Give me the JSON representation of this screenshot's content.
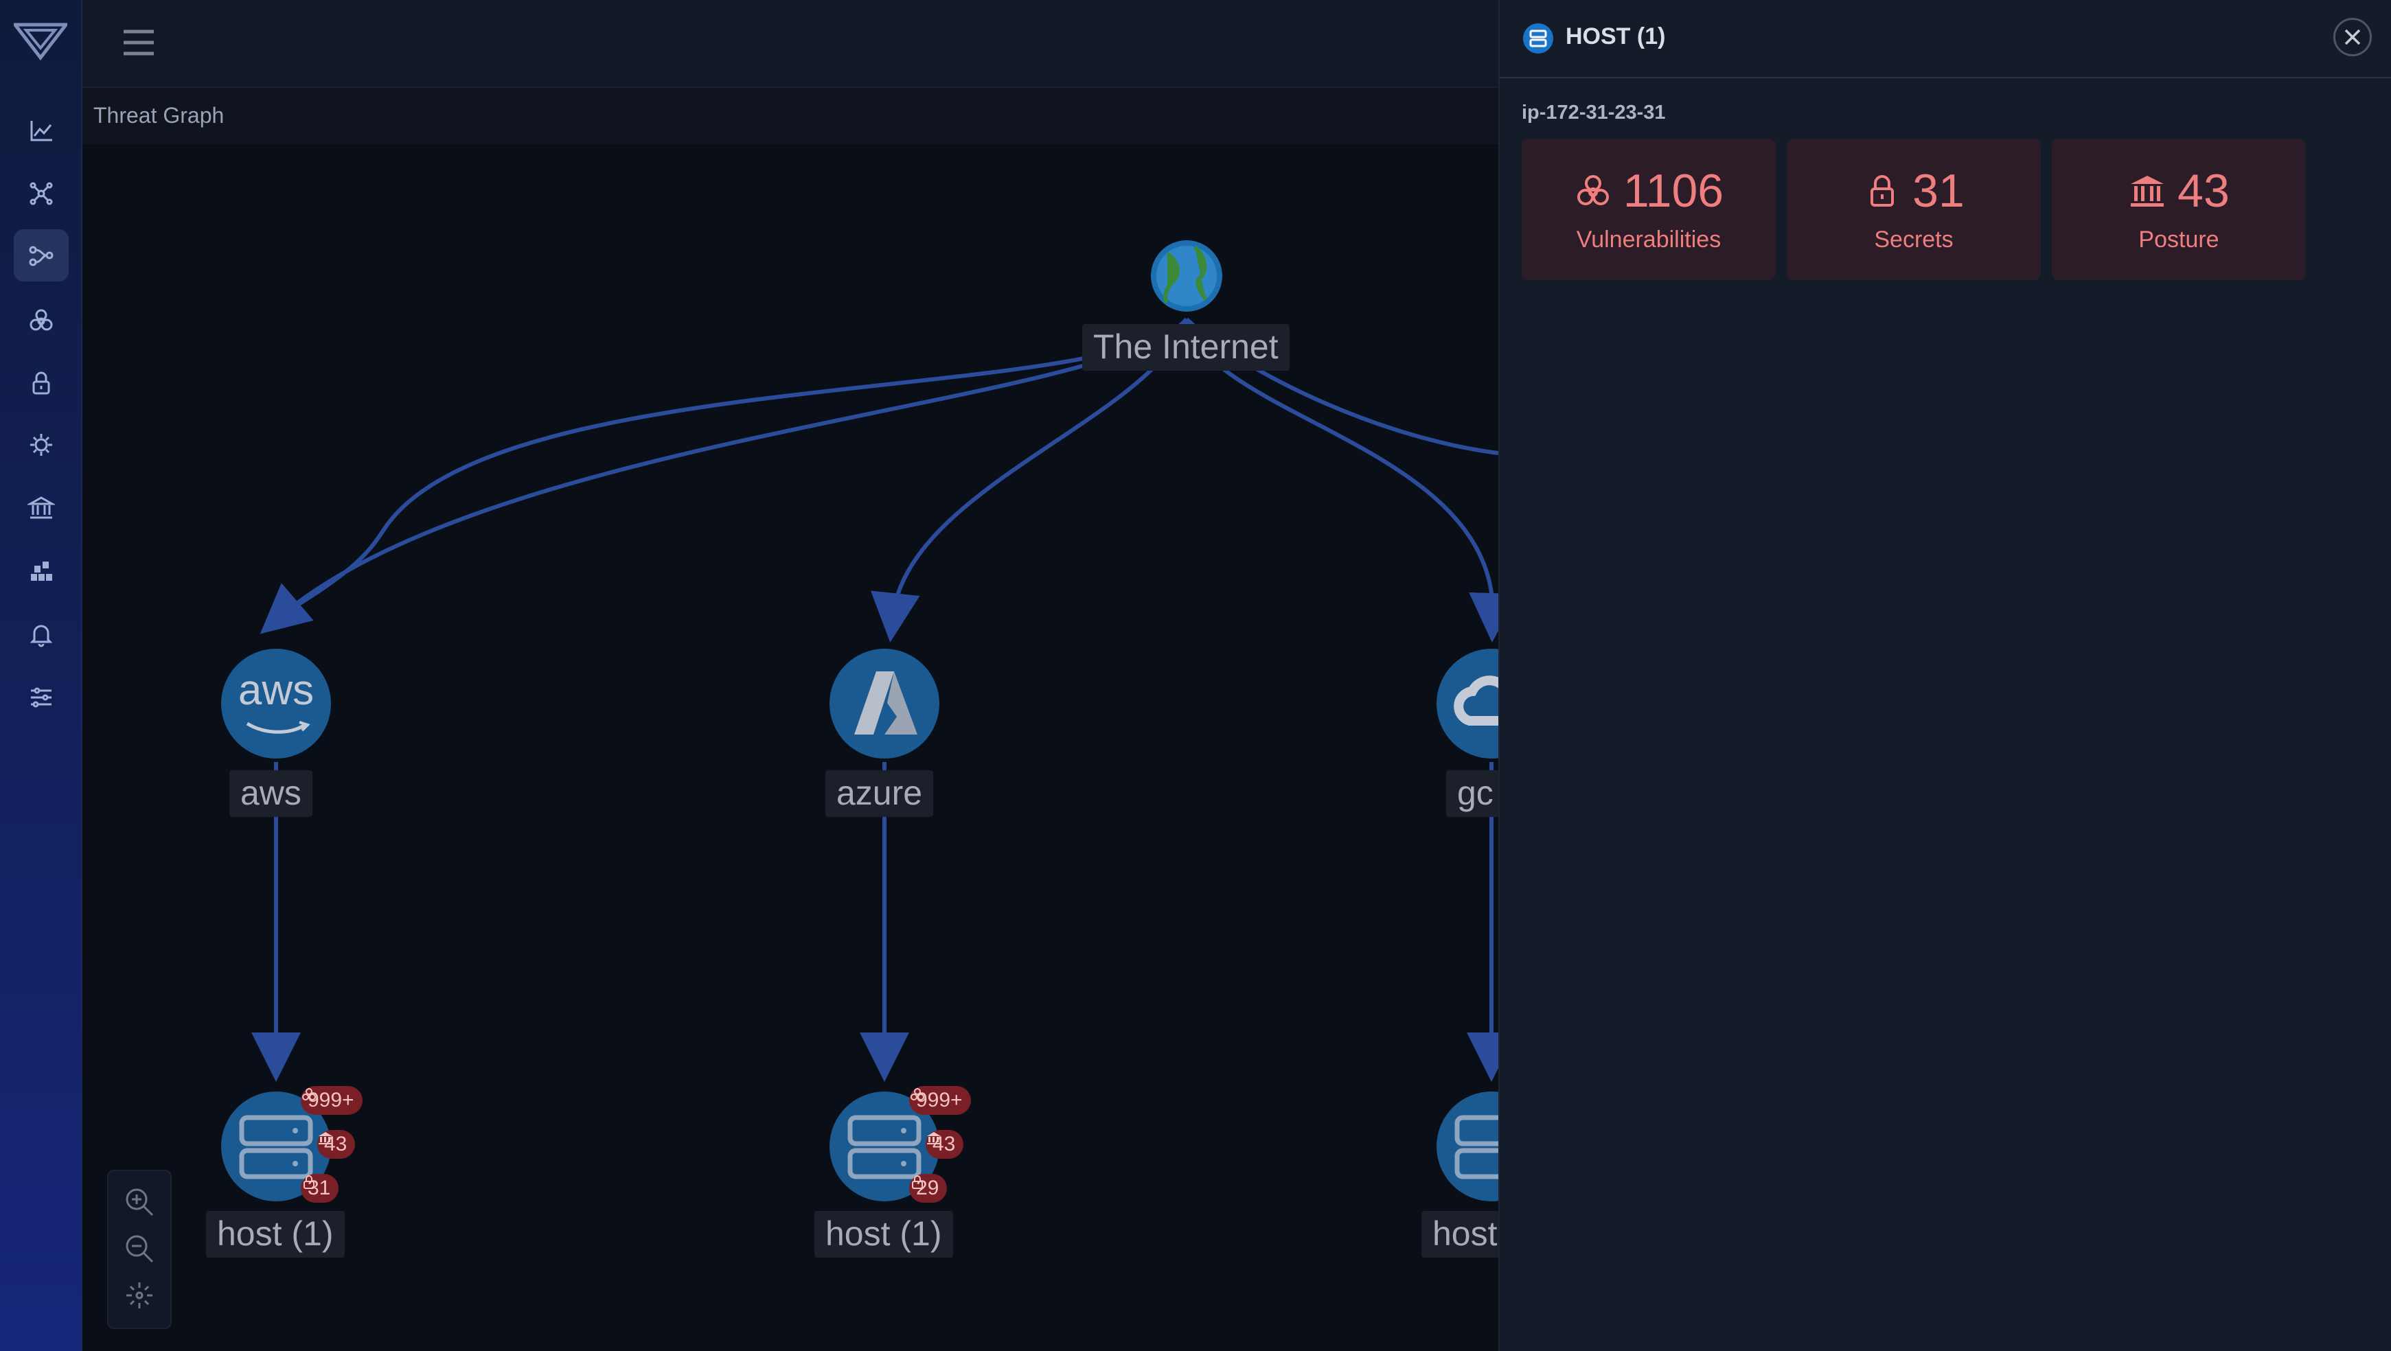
{
  "header": {
    "breadcrumb": "Threat Graph"
  },
  "graph": {
    "root": {
      "label": "The Internet",
      "icon": "globe-icon"
    },
    "clouds": [
      {
        "label": "aws",
        "icon": "aws-logo-icon"
      },
      {
        "label": "azure",
        "icon": "azure-logo-icon"
      },
      {
        "label": "gc",
        "icon": "gcp-logo-icon"
      }
    ],
    "hosts": [
      {
        "label": "host (1)",
        "vulnerabilities": "999+",
        "posture": "43",
        "secrets": "31"
      },
      {
        "label": "host (1)",
        "vulnerabilities": "999+",
        "posture": "43",
        "secrets": "29"
      },
      {
        "label": "host",
        "vulnerabilities": "",
        "posture": "",
        "secrets": ""
      }
    ]
  },
  "panel": {
    "title": "HOST (1)",
    "host_name": "ip-172-31-23-31",
    "stats": [
      {
        "value": "1106",
        "label": "Vulnerabilities",
        "icon": "biohazard-icon"
      },
      {
        "value": "31",
        "label": "Secrets",
        "icon": "lock-icon"
      },
      {
        "value": "43",
        "label": "Posture",
        "icon": "bank-icon"
      }
    ]
  },
  "colors": {
    "accent_blue": "#1a74c8",
    "edge": "#2a4c9a",
    "badge_red": "#7a1f26",
    "stat_text": "#ef7e7e",
    "stat_bg": "#2b1c28"
  }
}
